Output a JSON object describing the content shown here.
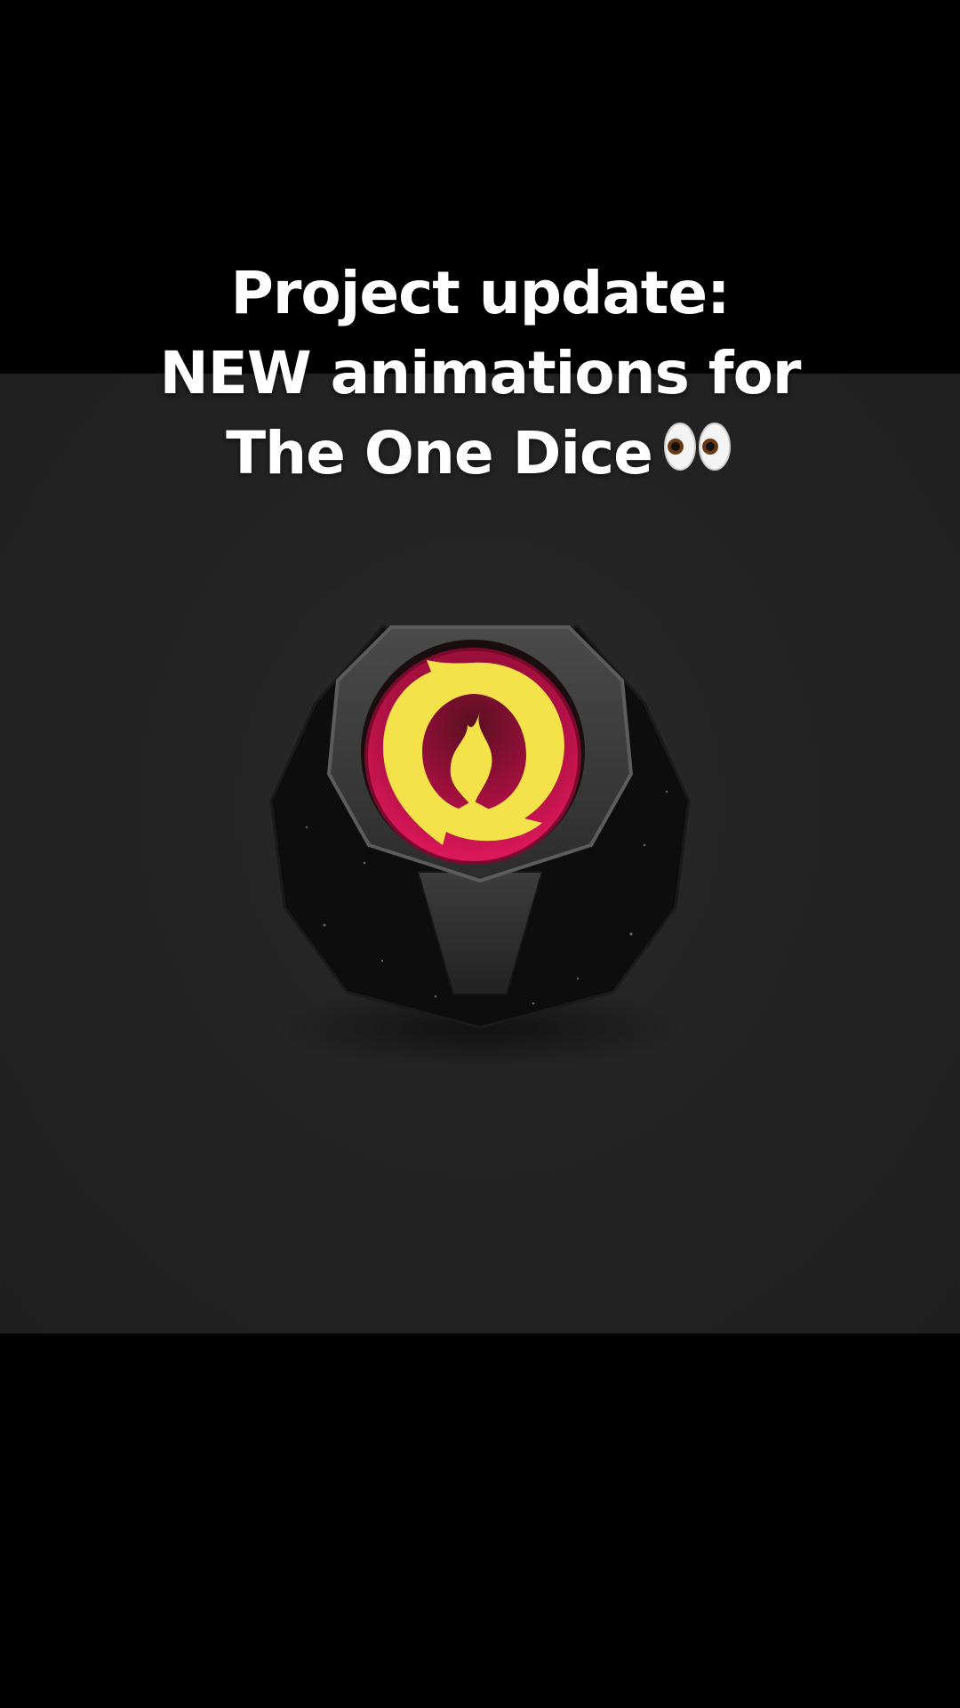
{
  "caption": {
    "line1": "Project update:",
    "line2": "NEW animations for",
    "line3": "The One Dice"
  },
  "icons": {
    "caption_emoji": "eyes-icon",
    "dice_face_symbol": "flame-ring-icon"
  },
  "colors": {
    "background_top": "#000000",
    "video_background": "#242424",
    "caption_text": "#ffffff",
    "dice_body": "#0e0e0e",
    "dice_face": "#3a3a3a",
    "symbol_disc": "#c2124e",
    "flame": "#f4e24a"
  }
}
